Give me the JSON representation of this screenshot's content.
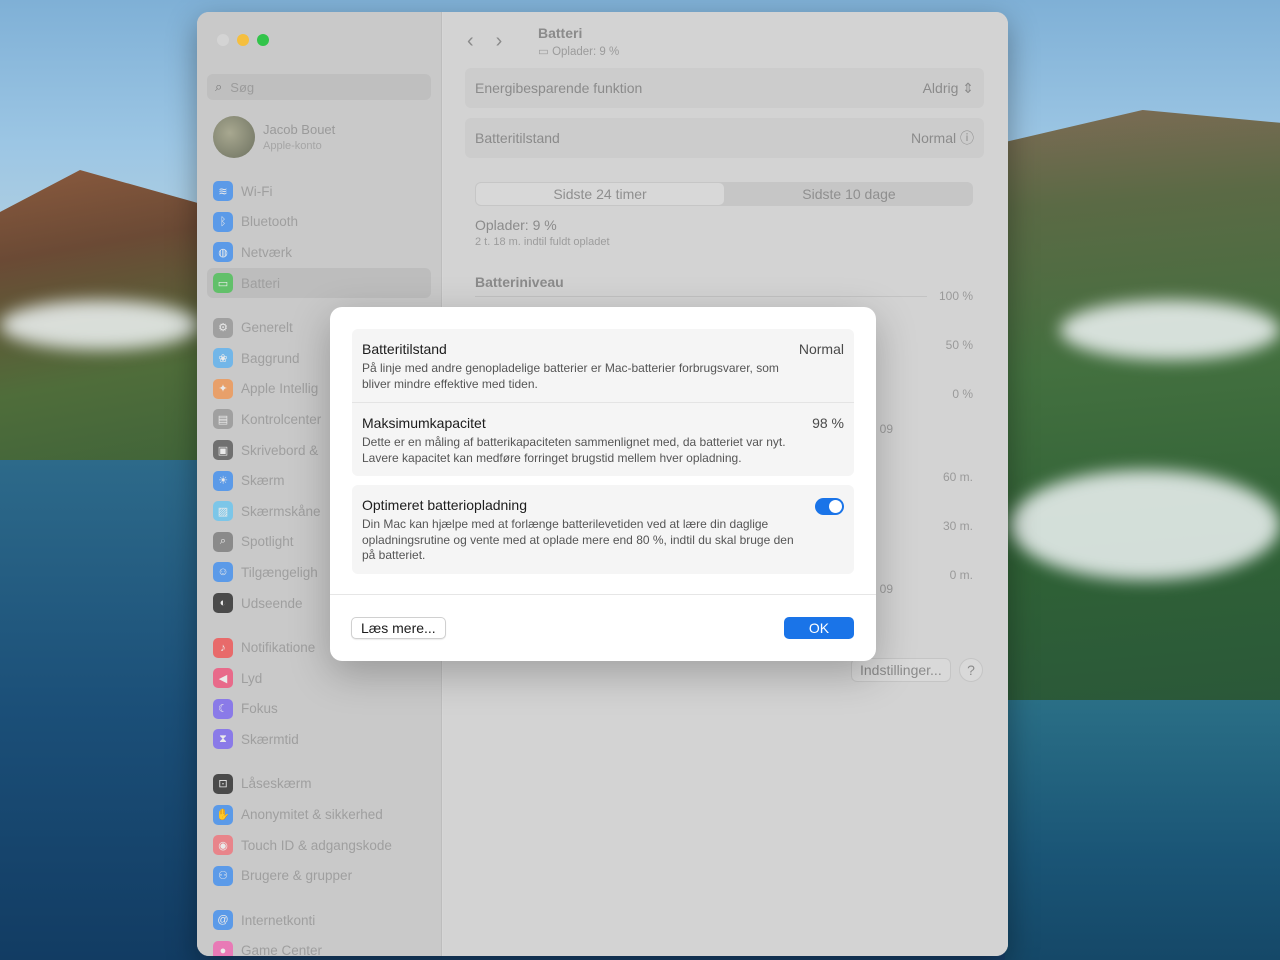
{
  "window": {
    "search_placeholder": "Søg",
    "account": {
      "name": "Jacob Bouet",
      "subtitle": "Apple-konto"
    }
  },
  "sidebar": {
    "items": [
      {
        "label": "Wi-Fi",
        "icon": "wifi-icon",
        "color": "#5b9ae8"
      },
      {
        "label": "Bluetooth",
        "icon": "bluetooth-icon",
        "color": "#5b9ae8"
      },
      {
        "label": "Netværk",
        "icon": "globe-icon",
        "color": "#5b9ae8"
      },
      {
        "label": "Batteri",
        "icon": "battery-icon",
        "color": "#62c06a"
      },
      {
        "label": "Generelt",
        "icon": "gear-icon",
        "color": "#a0a0a0"
      },
      {
        "label": "Baggrund",
        "icon": "wallpaper-icon",
        "color": "#72b6e8"
      },
      {
        "label": "Apple Intellig",
        "icon": "sparkle-icon",
        "color": "#e8a06a"
      },
      {
        "label": "Kontrolcenter",
        "icon": "control-center-icon",
        "color": "#a0a0a0"
      },
      {
        "label": "Skrivebord &",
        "icon": "desktop-icon",
        "color": "#707070"
      },
      {
        "label": "Skærm",
        "icon": "sun-icon",
        "color": "#5b9ae8"
      },
      {
        "label": "Skærmskåne",
        "icon": "screensaver-icon",
        "color": "#7cc6e8"
      },
      {
        "label": "Spotlight",
        "icon": "magnifier-icon",
        "color": "#8a8a8a"
      },
      {
        "label": "Tilgængeligh",
        "icon": "accessibility-icon",
        "color": "#5b9ae8"
      },
      {
        "label": "Udseende",
        "icon": "appearance-icon",
        "color": "#4a4a4a"
      },
      {
        "label": "Notifikatione",
        "icon": "bell-icon",
        "color": "#e86a6a"
      },
      {
        "label": "Lyd",
        "icon": "speaker-icon",
        "color": "#e86a8a"
      },
      {
        "label": "Fokus",
        "icon": "moon-icon",
        "color": "#8a7ae8"
      },
      {
        "label": "Skærmtid",
        "icon": "hourglass-icon",
        "color": "#8a7ae8"
      },
      {
        "label": "Låseskærm",
        "icon": "lock-icon",
        "color": "#4a4a4a"
      },
      {
        "label": "Anonymitet & sikkerhed",
        "icon": "hand-icon",
        "color": "#5b9ae8"
      },
      {
        "label": "Touch ID & adgangskode",
        "icon": "fingerprint-icon",
        "color": "#e8848a"
      },
      {
        "label": "Brugere & grupper",
        "icon": "users-icon",
        "color": "#5b9ae8"
      },
      {
        "label": "Internetkonti",
        "icon": "at-icon",
        "color": "#5b9ae8"
      },
      {
        "label": "Game Center",
        "icon": "gamecenter-icon",
        "color": "#e87ab6"
      }
    ]
  },
  "main": {
    "title": "Batteri",
    "subtitle": "Oplader: 9 %",
    "energy_label": "Energibesparende funktion",
    "energy_value": "Aldrig",
    "health_label": "Batteritilstand",
    "health_value": "Normal",
    "tabs": [
      "Sidste 24 timer",
      "Sidste 10 dage"
    ],
    "charging": "Oplader: 9 %",
    "charging_sub": "2 t. 18 m. indtil fuldt opladet",
    "level_title": "Batteriniveau",
    "axis_top": [
      "100 %",
      "50 %",
      "0 %"
    ],
    "axis_bottom": [
      "60 m.",
      "30 m.",
      "0 m."
    ],
    "tick_labels": [
      "09",
      "09"
    ],
    "settings_button": "Indstillinger...",
    "help_button": "?"
  },
  "modal": {
    "health_title": "Batteritilstand",
    "health_value": "Normal",
    "health_desc": "På linje med andre genopladelige batterier er Mac-batterier forbrugsvarer, som bliver mindre effektive med tiden.",
    "capacity_title": "Maksimumkapacitet",
    "capacity_value": "98 %",
    "capacity_desc": "Dette er en måling af batterikapaciteten sammenlignet med, da batteriet var nyt. Lavere kapacitet kan medføre forringet brugstid mellem hver opladning.",
    "optimized_title": "Optimeret batteriopladning",
    "optimized_desc": "Din Mac kan hjælpe med at forlænge batterilevetiden ved at lære din daglige opladningsrutine og vente med at oplade mere end 80 %, indtil du skal bruge den på batteriet.",
    "optimized_on": true,
    "learn_more": "Læs mere...",
    "ok": "OK",
    "accent": "#1a74e8"
  }
}
